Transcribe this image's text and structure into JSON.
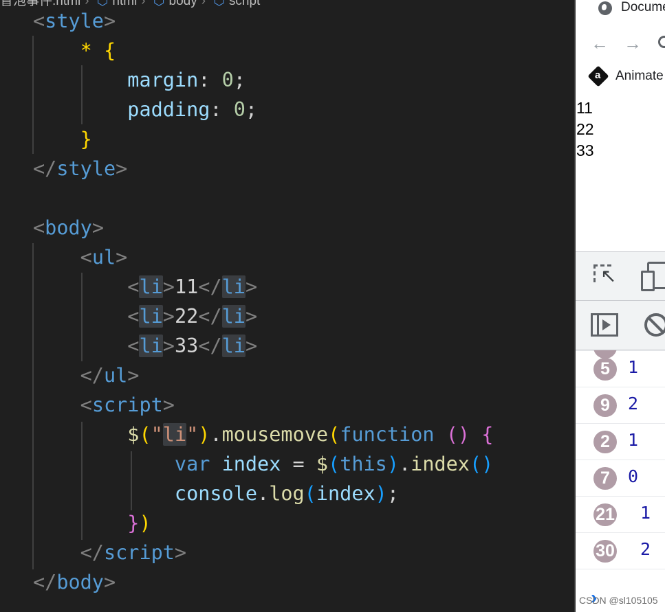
{
  "breadcrumb": {
    "file": "冒泡事件.html",
    "items": [
      "html",
      "body",
      "script"
    ]
  },
  "code_lines": [
    [
      [
        "tk-pun",
        "<"
      ],
      [
        "tk-tag",
        "style"
      ],
      [
        "tk-pun",
        ">"
      ]
    ],
    [
      [
        "tk-text",
        "    "
      ],
      [
        "tk-brace",
        "* {"
      ]
    ],
    [
      [
        "tk-text",
        "        "
      ],
      [
        "tk-prop",
        "margin"
      ],
      [
        "tk-text",
        ": "
      ],
      [
        "tk-num",
        "0"
      ],
      [
        "tk-text",
        ";"
      ]
    ],
    [
      [
        "tk-text",
        "        "
      ],
      [
        "tk-prop",
        "padding"
      ],
      [
        "tk-text",
        ": "
      ],
      [
        "tk-num",
        "0"
      ],
      [
        "tk-text",
        ";"
      ]
    ],
    [
      [
        "tk-text",
        "    "
      ],
      [
        "tk-brace",
        "}"
      ]
    ],
    [
      [
        "tk-pun",
        "</"
      ],
      [
        "tk-tag",
        "style"
      ],
      [
        "tk-pun",
        ">"
      ]
    ],
    [],
    [
      [
        "tk-pun",
        "<"
      ],
      [
        "tk-tag",
        "body"
      ],
      [
        "tk-pun",
        ">"
      ]
    ],
    [
      [
        "tk-text",
        "    "
      ],
      [
        "tk-pun",
        "<"
      ],
      [
        "tk-tag",
        "ul"
      ],
      [
        "tk-pun",
        ">"
      ]
    ],
    [
      [
        "tk-text",
        "        "
      ],
      [
        "tk-pun",
        "<"
      ],
      [
        "tk-tag tk-hl",
        "li"
      ],
      [
        "tk-pun",
        ">"
      ],
      [
        "tk-text",
        "11"
      ],
      [
        "tk-pun",
        "</"
      ],
      [
        "tk-tag tk-hl",
        "li"
      ],
      [
        "tk-pun",
        ">"
      ]
    ],
    [
      [
        "tk-text",
        "        "
      ],
      [
        "tk-pun",
        "<"
      ],
      [
        "tk-tag tk-hl",
        "li"
      ],
      [
        "tk-pun",
        ">"
      ],
      [
        "tk-text",
        "22"
      ],
      [
        "tk-pun",
        "</"
      ],
      [
        "tk-tag tk-hl",
        "li"
      ],
      [
        "tk-pun",
        ">"
      ]
    ],
    [
      [
        "tk-text",
        "        "
      ],
      [
        "tk-pun",
        "<"
      ],
      [
        "tk-tag tk-hl",
        "li"
      ],
      [
        "tk-pun",
        ">"
      ],
      [
        "tk-text",
        "33"
      ],
      [
        "tk-pun",
        "</"
      ],
      [
        "tk-tag tk-hl",
        "li"
      ],
      [
        "tk-pun",
        ">"
      ]
    ],
    [
      [
        "tk-text",
        "    "
      ],
      [
        "tk-pun",
        "</"
      ],
      [
        "tk-tag",
        "ul"
      ],
      [
        "tk-pun",
        ">"
      ]
    ],
    [
      [
        "tk-text",
        "    "
      ],
      [
        "tk-pun",
        "<"
      ],
      [
        "tk-tag",
        "script"
      ],
      [
        "tk-pun",
        ">"
      ]
    ],
    [
      [
        "tk-text",
        "        "
      ],
      [
        "tk-fn",
        "$"
      ],
      [
        "tk-brace",
        "("
      ],
      [
        "tk-str",
        "\""
      ],
      [
        "tk-str tk-hl",
        "li"
      ],
      [
        "tk-str",
        "\""
      ],
      [
        "tk-brace",
        ")"
      ],
      [
        "tk-text",
        "."
      ],
      [
        "tk-fn",
        "mousemove"
      ],
      [
        "tk-brace",
        "("
      ],
      [
        "tk-kw",
        "function"
      ],
      [
        "tk-text",
        " "
      ],
      [
        "tk-paren",
        "()"
      ],
      [
        "tk-text",
        " "
      ],
      [
        "tk-paren",
        "{"
      ]
    ],
    [
      [
        "tk-text",
        "            "
      ],
      [
        "tk-kw",
        "var"
      ],
      [
        "tk-text",
        " "
      ],
      [
        "tk-prop",
        "index"
      ],
      [
        "tk-text",
        " = "
      ],
      [
        "tk-fn",
        "$"
      ],
      [
        "tk-paren2",
        "("
      ],
      [
        "tk-kw",
        "this"
      ],
      [
        "tk-paren2",
        ")"
      ],
      [
        "tk-text",
        "."
      ],
      [
        "tk-fn",
        "index"
      ],
      [
        "tk-paren2",
        "()"
      ]
    ],
    [
      [
        "tk-text",
        "            "
      ],
      [
        "tk-prop",
        "console"
      ],
      [
        "tk-text",
        "."
      ],
      [
        "tk-fn",
        "log"
      ],
      [
        "tk-paren2",
        "("
      ],
      [
        "tk-prop",
        "index"
      ],
      [
        "tk-paren2",
        ")"
      ],
      [
        "tk-text",
        ";"
      ]
    ],
    [
      [
        "tk-text",
        "        "
      ],
      [
        "tk-paren",
        "}"
      ],
      [
        "tk-brace",
        ")"
      ]
    ],
    [
      [
        "tk-text",
        "    "
      ],
      [
        "tk-pun",
        "</"
      ],
      [
        "tk-tag",
        "script"
      ],
      [
        "tk-pun",
        ">"
      ]
    ],
    [
      [
        "tk-pun",
        "</"
      ],
      [
        "tk-tag",
        "body"
      ],
      [
        "tk-pun",
        ">"
      ]
    ]
  ],
  "browser": {
    "tab_title": "Document",
    "back_glyph": "←",
    "forward_glyph": "→",
    "bookmark": "Animate",
    "page_items": [
      "11",
      "22",
      "33"
    ]
  },
  "console": {
    "rows": [
      {
        "count": "5",
        "value": "1"
      },
      {
        "count": "9",
        "value": "2"
      },
      {
        "count": "2",
        "value": "1"
      },
      {
        "count": "7",
        "value": "0"
      },
      {
        "count": "21",
        "value": "1"
      },
      {
        "count": "30",
        "value": "2"
      }
    ],
    "prompt": "›"
  },
  "watermark": "CSDN @sl105105",
  "icons": {
    "breadcrumb": "code-element-icon",
    "tab": "globe-icon",
    "bookmark": "animate-icon",
    "devtools": [
      "inspect-element-icon",
      "device-toolbar-icon",
      "sidebar-icon",
      "clear-console-icon"
    ]
  },
  "colors": {
    "editor_bg": "#1f1f1f",
    "tag": "#569cd6",
    "property": "#9cdcfe",
    "number": "#b5cea8",
    "bracket": "#ffd700",
    "string": "#ce9178",
    "function": "#dcdcaa",
    "badge": "#b09ca6",
    "log_value": "#1a1aa6"
  }
}
